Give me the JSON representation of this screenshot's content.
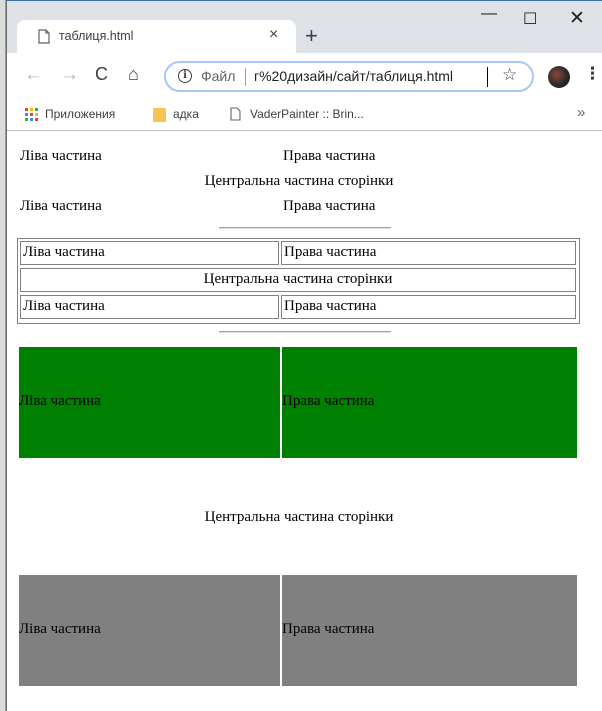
{
  "browser": {
    "tab_title": "таблиця.html",
    "tab_close": "×",
    "new_tab": "+",
    "window_controls": {
      "minimize": "—",
      "maximize": "☐",
      "close": "✕"
    },
    "nav": {
      "back": "←",
      "forward": "→",
      "reload": "C",
      "home": "⌂"
    },
    "address": {
      "scheme_label": "Файл",
      "url": "г%20дизайн/сайт/таблиця.html"
    },
    "bookmark_star": "☆",
    "menu": "⋮",
    "bookmarks": [
      {
        "label": "Приложения",
        "icon": "apps-grid-icon"
      },
      {
        "label": "адка",
        "icon": "folder-icon"
      },
      {
        "label": "VaderPainter :: Brin...",
        "icon": "page-icon"
      }
    ],
    "bookmarks_overflow": "»"
  },
  "page": {
    "section1": {
      "row1": {
        "left": "Ліва частина",
        "right": "Права частина"
      },
      "row2": {
        "center": "Центральна частина сторінки"
      },
      "row3": {
        "left": "Ліва частина",
        "right": "Права частина"
      }
    },
    "section2": {
      "row1": {
        "left": "Ліва частина",
        "right": "Права частина"
      },
      "row2": {
        "center": "Центральна частина сторінки"
      },
      "row3": {
        "left": "Ліва частина",
        "right": "Права частина"
      }
    },
    "section3": {
      "top": {
        "left": "Ліва частина",
        "right": "Права частина",
        "color": "#008000"
      },
      "center": "Центральна частина сторінки",
      "bottom": {
        "left": "Ліва частина",
        "right": "Права частина",
        "color": "#808080"
      }
    }
  }
}
